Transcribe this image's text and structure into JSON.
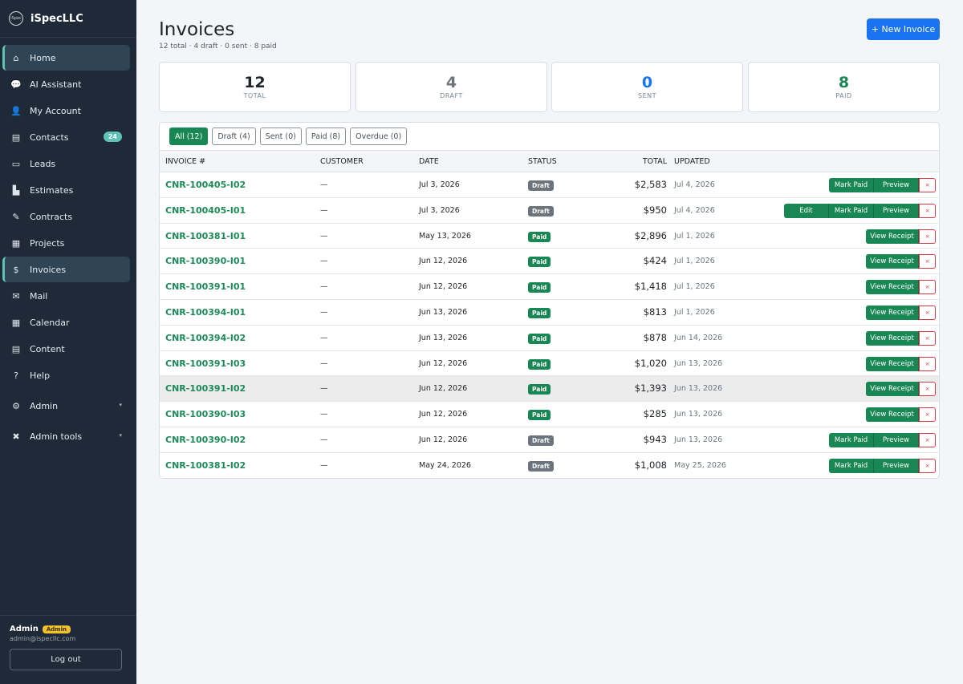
{
  "app": {
    "brand": "iSpecLLC",
    "logo_text": "iSpec"
  },
  "sidebar": {
    "items": [
      {
        "label": "Home",
        "icon": "home-icon",
        "glyph": "⌂",
        "active": true
      },
      {
        "label": "AI Assistant",
        "icon": "chat-icon",
        "glyph": "💬"
      },
      {
        "label": "My Account",
        "icon": "user-icon",
        "glyph": "👤"
      },
      {
        "label": "Contacts",
        "icon": "address-book-icon",
        "glyph": "▤",
        "badge": "24"
      },
      {
        "label": "Leads",
        "icon": "inbox-icon",
        "glyph": "▭"
      },
      {
        "label": "Estimates",
        "icon": "chart-icon",
        "glyph": "▙"
      },
      {
        "label": "Contracts",
        "icon": "signature-icon",
        "glyph": "✎"
      },
      {
        "label": "Projects",
        "icon": "clipboard-icon",
        "glyph": "▦"
      },
      {
        "label": "Invoices",
        "icon": "invoice-icon",
        "glyph": "$",
        "active": true
      },
      {
        "label": "Mail",
        "icon": "envelope-icon",
        "glyph": "✉"
      },
      {
        "label": "Calendar",
        "icon": "calendar-icon",
        "glyph": "▦"
      },
      {
        "label": "Content",
        "icon": "document-icon",
        "glyph": "▤"
      },
      {
        "label": "Help",
        "icon": "help-icon",
        "glyph": "?"
      }
    ],
    "groups": [
      {
        "label": "Admin",
        "icon": "gear-icon",
        "glyph": "⚙",
        "caret": "▾"
      },
      {
        "label": "Admin tools",
        "icon": "tools-icon",
        "glyph": "✖",
        "caret": "▾"
      }
    ],
    "footer": {
      "user_name": "Admin",
      "role": "Admin",
      "email": "admin@ispecllc.com",
      "logout_label": "Log out"
    }
  },
  "header": {
    "title": "Invoices",
    "subtitle": "12 total · 4 draft · 0 sent · 8 paid",
    "new_button": "+ New Invoice"
  },
  "stats": [
    {
      "value": "12",
      "label": "TOTAL",
      "color": "#212529"
    },
    {
      "value": "4",
      "label": "DRAFT",
      "color": "#6c757d"
    },
    {
      "value": "0",
      "label": "SENT",
      "color": "#1a74f2"
    },
    {
      "value": "8",
      "label": "PAID",
      "color": "#198754"
    }
  ],
  "filters": [
    {
      "label": "All (12)",
      "active": true
    },
    {
      "label": "Draft (4)"
    },
    {
      "label": "Sent (0)"
    },
    {
      "label": "Paid (8)"
    },
    {
      "label": "Overdue (0)"
    }
  ],
  "table": {
    "columns": {
      "invoice": "INVOICE #",
      "customer": "CUSTOMER",
      "date": "DATE",
      "status": "STATUS",
      "total": "TOTAL",
      "updated": "UPDATED"
    },
    "action_labels": {
      "edit": "Edit",
      "mark_paid": "Mark Paid",
      "preview": "Preview",
      "view_receipt": "View Receipt",
      "delete": "×"
    },
    "rows": [
      {
        "invoice": "CNR-100405-I02",
        "customer": "—",
        "date": "Jul 3, 2026",
        "status": "Draft",
        "total": "$2,583",
        "updated": "Jul 4, 2026",
        "actions": [
          "mark_paid",
          "preview"
        ]
      },
      {
        "invoice": "CNR-100405-I01",
        "customer": "—",
        "date": "Jul 3, 2026",
        "status": "Draft",
        "total": "$950",
        "updated": "Jul 4, 2026",
        "actions": [
          "edit",
          "mark_paid",
          "preview"
        ]
      },
      {
        "invoice": "CNR-100381-I01",
        "customer": "—",
        "date": "May 13, 2026",
        "status": "Paid",
        "total": "$2,896",
        "updated": "Jul 1, 2026",
        "actions": [
          "view_receipt"
        ]
      },
      {
        "invoice": "CNR-100390-I01",
        "customer": "—",
        "date": "Jun 12, 2026",
        "status": "Paid",
        "total": "$424",
        "updated": "Jul 1, 2026",
        "actions": [
          "view_receipt"
        ]
      },
      {
        "invoice": "CNR-100391-I01",
        "customer": "—",
        "date": "Jun 12, 2026",
        "status": "Paid",
        "total": "$1,418",
        "updated": "Jul 1, 2026",
        "actions": [
          "view_receipt"
        ]
      },
      {
        "invoice": "CNR-100394-I01",
        "customer": "—",
        "date": "Jun 13, 2026",
        "status": "Paid",
        "total": "$813",
        "updated": "Jul 1, 2026",
        "actions": [
          "view_receipt"
        ]
      },
      {
        "invoice": "CNR-100394-I02",
        "customer": "—",
        "date": "Jun 13, 2026",
        "status": "Paid",
        "total": "$878",
        "updated": "Jun 14, 2026",
        "actions": [
          "view_receipt"
        ]
      },
      {
        "invoice": "CNR-100391-I03",
        "customer": "—",
        "date": "Jun 12, 2026",
        "status": "Paid",
        "total": "$1,020",
        "updated": "Jun 13, 2026",
        "actions": [
          "view_receipt"
        ]
      },
      {
        "invoice": "CNR-100391-I02",
        "customer": "—",
        "date": "Jun 12, 2026",
        "status": "Paid",
        "total": "$1,393",
        "updated": "Jun 13, 2026",
        "actions": [
          "view_receipt"
        ],
        "hover": true
      },
      {
        "invoice": "CNR-100390-I03",
        "customer": "—",
        "date": "Jun 12, 2026",
        "status": "Paid",
        "total": "$285",
        "updated": "Jun 13, 2026",
        "actions": [
          "view_receipt"
        ]
      },
      {
        "invoice": "CNR-100390-I02",
        "customer": "—",
        "date": "Jun 12, 2026",
        "status": "Draft",
        "total": "$943",
        "updated": "Jun 13, 2026",
        "actions": [
          "mark_paid",
          "preview"
        ]
      },
      {
        "invoice": "CNR-100381-I02",
        "customer": "—",
        "date": "May 24, 2026",
        "status": "Draft",
        "total": "$1,008",
        "updated": "May 25, 2026",
        "actions": [
          "mark_paid",
          "preview"
        ]
      }
    ]
  }
}
